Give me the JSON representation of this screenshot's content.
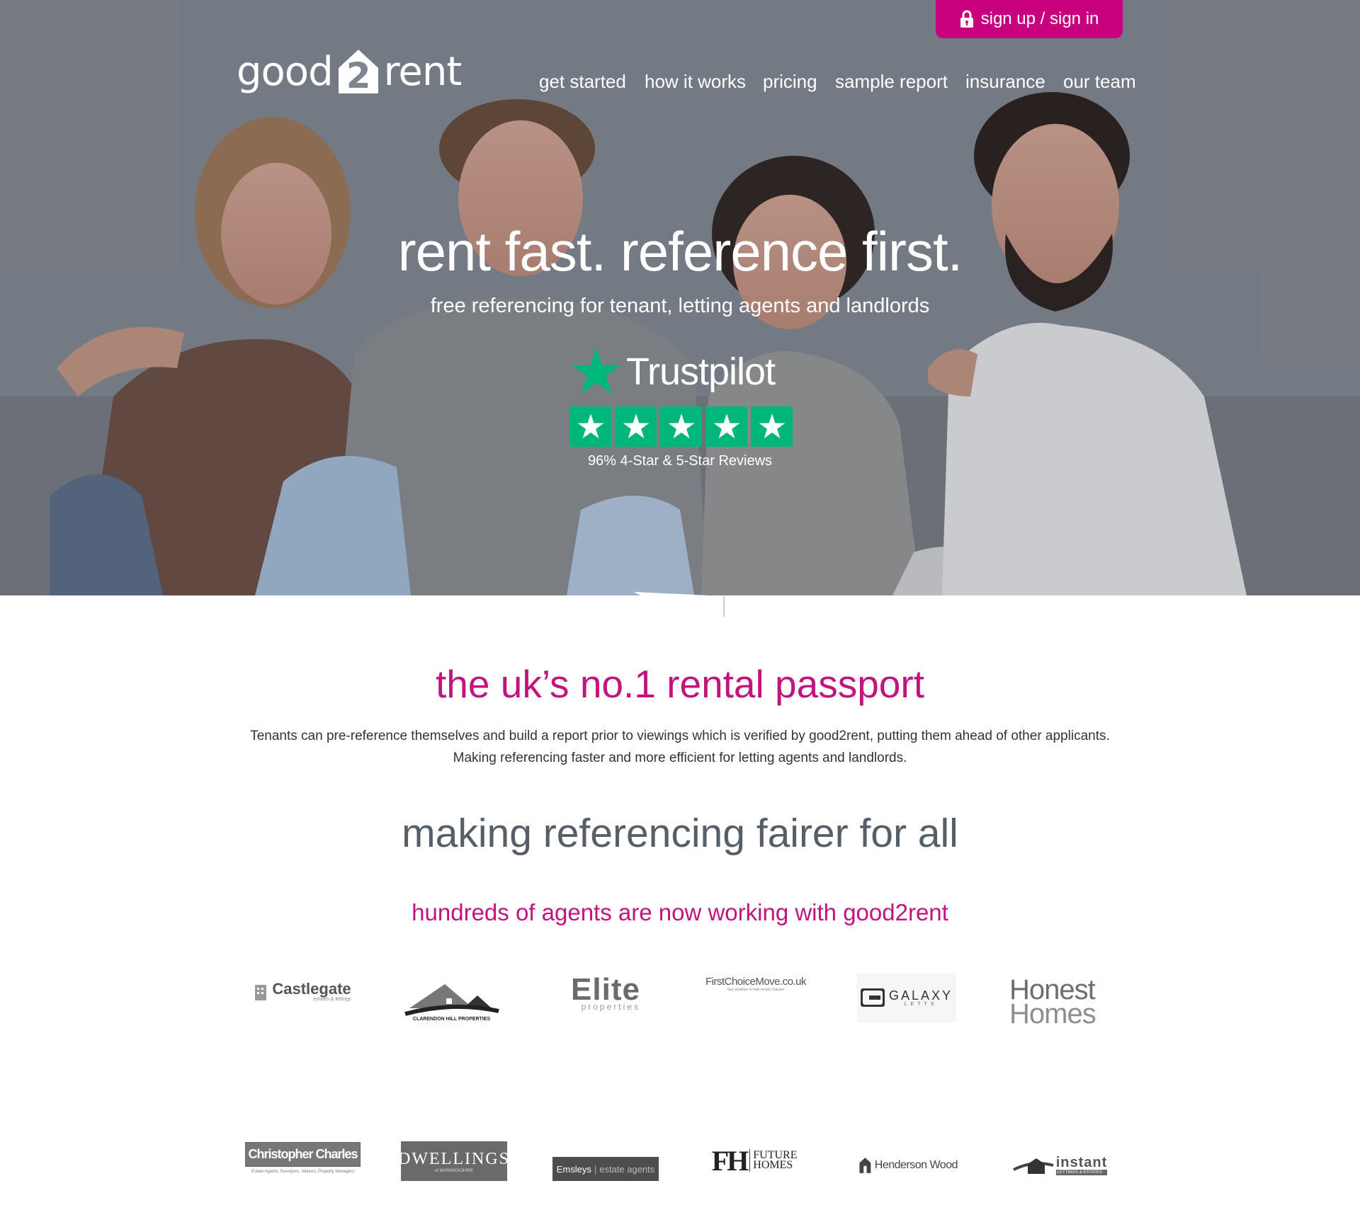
{
  "header": {
    "signin_label": "sign up / sign in",
    "logo_left": "good",
    "logo_mid": "2",
    "logo_right": "rent",
    "nav": [
      "get started",
      "how it works",
      "pricing",
      "sample report",
      "insurance",
      "our team"
    ]
  },
  "hero": {
    "headline": "rent fast. reference first.",
    "subheadline": "free referencing for tenant, letting agents and landlords",
    "trustpilot": {
      "name": "Trustpilot",
      "stars": 5,
      "caption": "96% 4-Star & 5-Star Reviews"
    }
  },
  "passport": {
    "title": "the uk’s no.1 rental passport",
    "line1": "Tenants can pre-reference themselves and build a report prior to viewings which is verified by good2rent, putting them ahead of other applicants.",
    "line2": "Making referencing faster and more efficient for letting agents and landlords."
  },
  "fairer": {
    "title": "making referencing fairer for all"
  },
  "agents": {
    "title": "hundreds of agents are now working with good2rent",
    "row1": [
      {
        "name": "Castlegate",
        "sub": "estates & lettings"
      },
      {
        "name": "CLARENDON HILL PROPERTIES"
      },
      {
        "name": "Elite",
        "sub": "properties"
      },
      {
        "name": "FirstChoiceMove.co.uk",
        "sub": "Say goodbye to high tenant charges"
      },
      {
        "name": "GALAXY",
        "sub": "LETTS"
      },
      {
        "name": "Honest",
        "sub": "Homes"
      }
    ],
    "row2": [
      {
        "name": "Christopher Charles",
        "sub": "Estate Agents, Surveyors, Valuers, Property Managers"
      },
      {
        "name": "DWELLINGS",
        "sub": "of WARWICKSHIRE"
      },
      {
        "name": "Emsleys",
        "sub": "estate agents"
      },
      {
        "name": "FUTURE HOMES",
        "sub": "FH"
      },
      {
        "name": "Henderson Wood"
      },
      {
        "name": "instant",
        "sub": "LETTINGS & ESTATES"
      }
    ]
  },
  "colors": {
    "brand_pink": "#c8007e",
    "heading_pink": "#c2147d",
    "trustpilot_green": "#00b67a",
    "heading_grey": "#565e68"
  }
}
